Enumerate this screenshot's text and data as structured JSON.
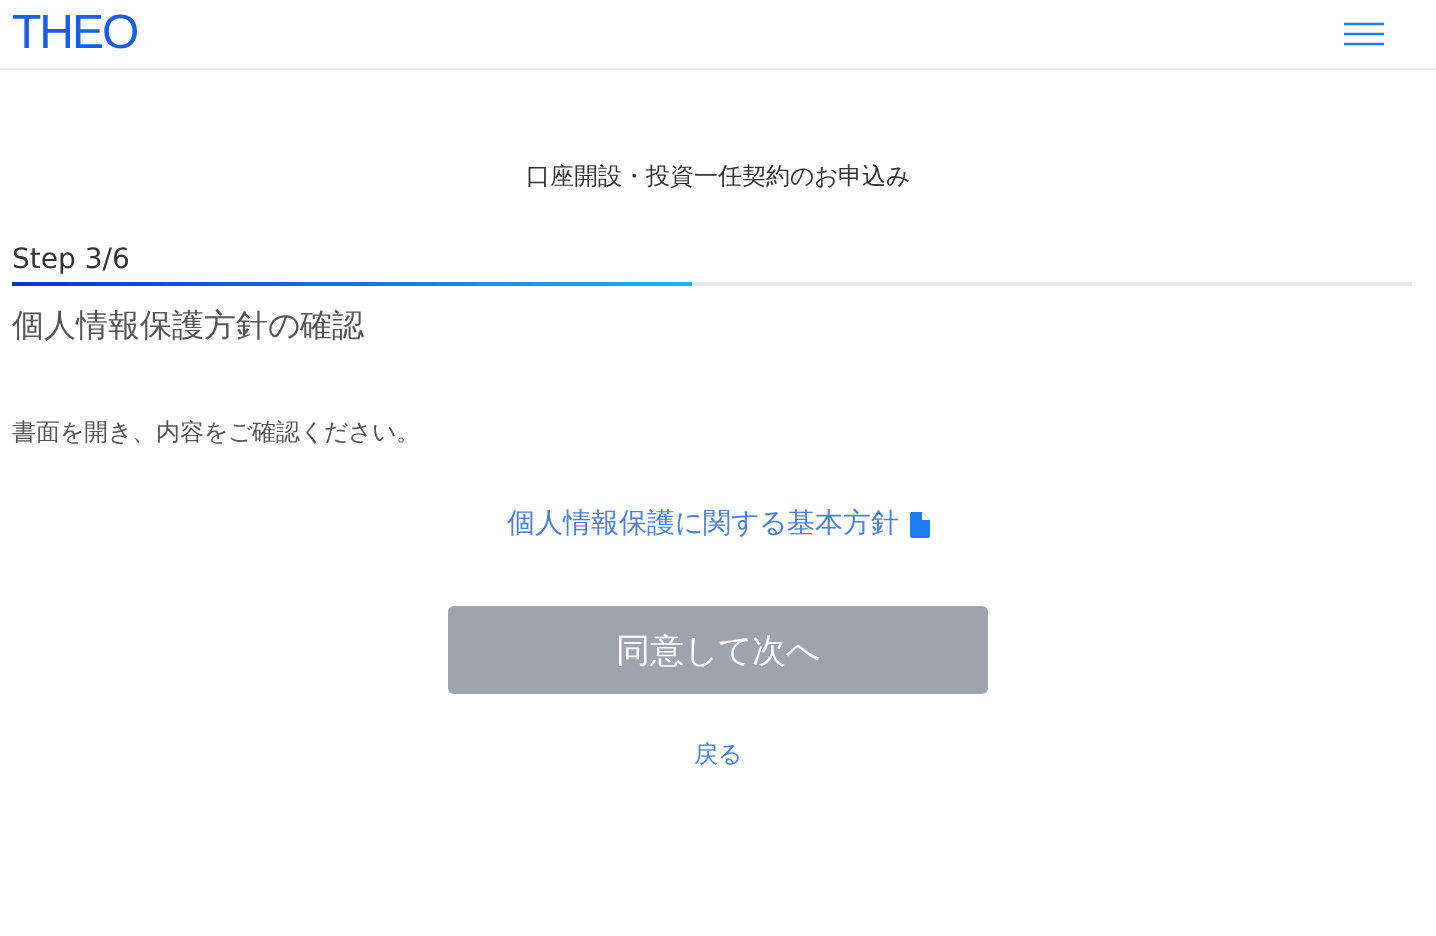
{
  "header": {
    "logo": "THEO"
  },
  "page_title": "口座開設・投資一任契約のお申込み",
  "progress": {
    "label": "Step 3/6",
    "level": 0.485
  },
  "heading": "個人情報保護方針の確認",
  "instruction": "書面を開き、内容をご確認ください。",
  "document_link": "個人情報保護に関する基本方針",
  "submit": {
    "label": "同意して次へ",
    "disabled": true
  },
  "back_link": "戻る"
}
